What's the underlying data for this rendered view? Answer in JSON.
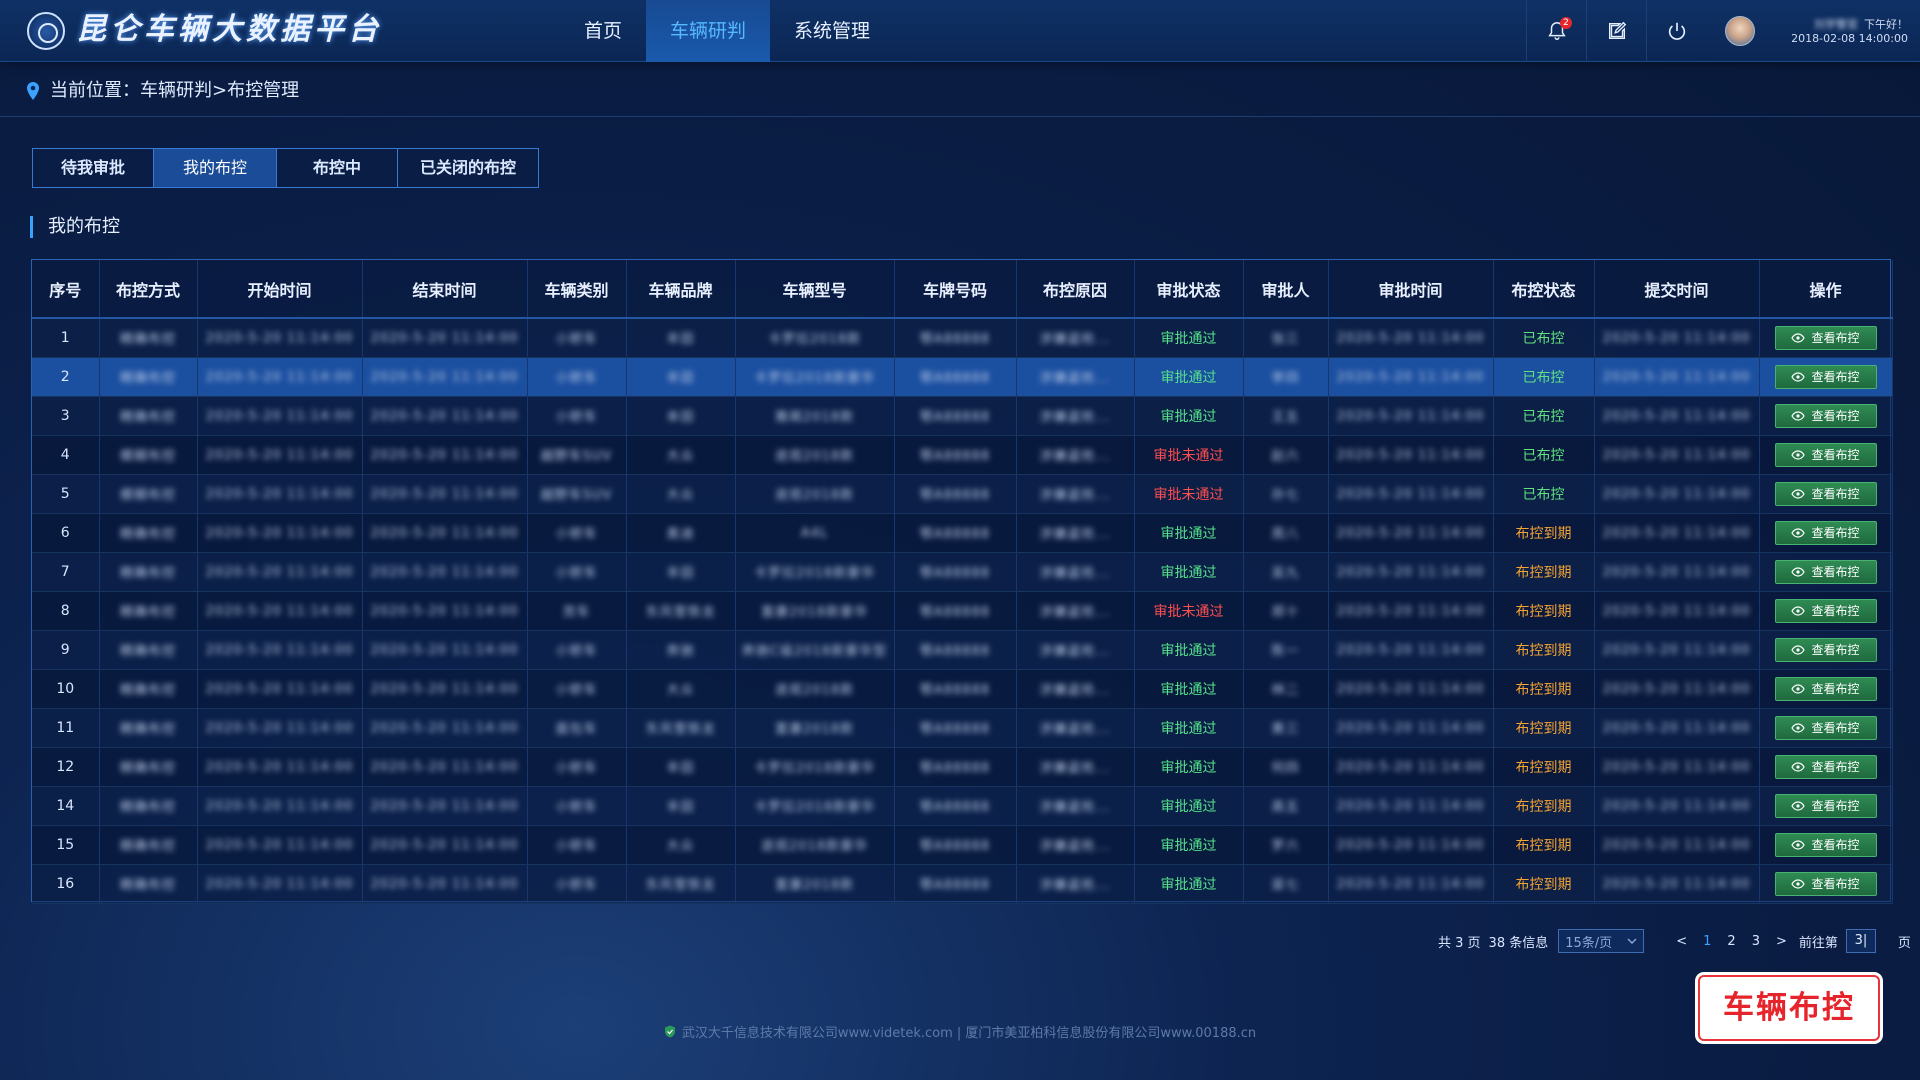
{
  "header": {
    "brand": "昆仑车辆大数据平台",
    "nav": [
      {
        "label": "首页",
        "active": false
      },
      {
        "label": "车辆研判",
        "active": true
      },
      {
        "label": "系统管理",
        "active": false
      }
    ],
    "notification_count": "2",
    "user": {
      "name": "刘学警官",
      "greeting": "下午好！",
      "datetime": "2018-02-08 14:00:00"
    }
  },
  "breadcrumb": {
    "prefix": "当前位置：",
    "items": [
      "车辆研判",
      "布控管理"
    ],
    "separator": ">"
  },
  "tabs": [
    {
      "label": "待我审批",
      "active": false
    },
    {
      "label": "我的布控",
      "active": true
    },
    {
      "label": "布控中",
      "active": false
    },
    {
      "label": "已关闭的布控",
      "active": false
    }
  ],
  "section_title": "我的布控",
  "table": {
    "columns": [
      "序号",
      "布控方式",
      "开始时间",
      "结束时间",
      "车辆类别",
      "车辆品牌",
      "车辆型号",
      "车牌号码",
      "布控原因",
      "审批状态",
      "审批人",
      "审批时间",
      "布控状态",
      "提交时间",
      "操作"
    ],
    "action_label": "查看布控",
    "rows": [
      {
        "no": "1",
        "method": "精确布控",
        "start": "2020-5-20 11:14:00",
        "end": "2020-5-20 11:14:00",
        "type": "小轿车",
        "brand": "丰田",
        "model": "卡罗拉2018款",
        "plate": "鄂A88888",
        "reason": "涉嫌盗抢...",
        "approval": "审批通过",
        "approver": "张三",
        "approve_time": "2020-5-20 11:14:00",
        "status": "已布控",
        "submit_time": "2020-5-20 11:14:00"
      },
      {
        "no": "2",
        "method": "精确布控",
        "start": "2020-5-20 11:14:00",
        "end": "2020-5-20 11:14:00",
        "type": "小轿车",
        "brand": "丰田",
        "model": "卡罗拉2018款豪华",
        "plate": "鄂A88888",
        "reason": "涉嫌盗抢...",
        "approval": "审批通过",
        "approver": "李四",
        "approve_time": "2020-5-20 11:14:00",
        "status": "已布控",
        "submit_time": "2020-5-20 11:14:00"
      },
      {
        "no": "3",
        "method": "精确布控",
        "start": "2020-5-20 11:14:00",
        "end": "2020-5-20 11:14:00",
        "type": "小轿车",
        "brand": "本田",
        "model": "雅阁2018款",
        "plate": "鄂A88888",
        "reason": "涉嫌盗抢...",
        "approval": "审批通过",
        "approver": "王五",
        "approve_time": "2020-5-20 11:14:00",
        "status": "已布控",
        "submit_time": "2020-5-20 11:14:00"
      },
      {
        "no": "4",
        "method": "模糊布控",
        "start": "2020-5-20 11:14:00",
        "end": "2020-5-20 11:14:00",
        "type": "越野车SUV",
        "brand": "大众",
        "model": "途观2018款",
        "plate": "鄂A88888",
        "reason": "涉嫌盗抢...",
        "approval": "审批未通过",
        "approver": "赵六",
        "approve_time": "2020-5-20 11:14:00",
        "status": "已布控",
        "submit_time": "2020-5-20 11:14:00"
      },
      {
        "no": "5",
        "method": "模糊布控",
        "start": "2020-5-20 11:14:00",
        "end": "2020-5-20 11:14:00",
        "type": "越野车SUV",
        "brand": "大众",
        "model": "途观2018款",
        "plate": "鄂A88888",
        "reason": "涉嫌盗抢...",
        "approval": "审批未通过",
        "approver": "孙七",
        "approve_time": "2020-5-20 11:14:00",
        "status": "已布控",
        "submit_time": "2020-5-20 11:14:00"
      },
      {
        "no": "6",
        "method": "精确布控",
        "start": "2020-5-20 11:14:00",
        "end": "2020-5-20 11:14:00",
        "type": "小轿车",
        "brand": "奥迪",
        "model": "A4L",
        "plate": "鄂A88888",
        "reason": "涉嫌盗抢...",
        "approval": "审批通过",
        "approver": "周八",
        "approve_time": "2020-5-20 11:14:00",
        "status": "布控到期",
        "submit_time": "2020-5-20 11:14:00"
      },
      {
        "no": "7",
        "method": "精确布控",
        "start": "2020-5-20 11:14:00",
        "end": "2020-5-20 11:14:00",
        "type": "小轿车",
        "brand": "丰田",
        "model": "卡罗拉2018款豪华",
        "plate": "鄂A88888",
        "reason": "涉嫌盗抢...",
        "approval": "审批通过",
        "approver": "吴九",
        "approve_time": "2020-5-20 11:14:00",
        "status": "布控到期",
        "submit_time": "2020-5-20 11:14:00"
      },
      {
        "no": "8",
        "method": "精确布控",
        "start": "2020-5-20 11:14:00",
        "end": "2020-5-20 11:14:00",
        "type": "货车",
        "brand": "东风雪铁龙",
        "model": "富康2018款豪华",
        "plate": "鄂A88888",
        "reason": "涉嫌盗抢...",
        "approval": "审批未通过",
        "approver": "郑十",
        "approve_time": "2020-5-20 11:14:00",
        "status": "布控到期",
        "submit_time": "2020-5-20 11:14:00"
      },
      {
        "no": "9",
        "method": "精确布控",
        "start": "2020-5-20 11:14:00",
        "end": "2020-5-20 11:14:00",
        "type": "小轿车",
        "brand": "奔驰",
        "model": "奔驰C级2018款豪华型",
        "plate": "鄂A88888",
        "reason": "涉嫌盗抢...",
        "approval": "审批通过",
        "approver": "陈一",
        "approve_time": "2020-5-20 11:14:00",
        "status": "布控到期",
        "submit_time": "2020-5-20 11:14:00"
      },
      {
        "no": "10",
        "method": "精确布控",
        "start": "2020-5-20 11:14:00",
        "end": "2020-5-20 11:14:00",
        "type": "小轿车",
        "brand": "大众",
        "model": "途观2018款",
        "plate": "鄂A88888",
        "reason": "涉嫌盗抢...",
        "approval": "审批通过",
        "approver": "林二",
        "approve_time": "2020-5-20 11:14:00",
        "status": "布控到期",
        "submit_time": "2020-5-20 11:14:00"
      },
      {
        "no": "11",
        "method": "精确布控",
        "start": "2020-5-20 11:14:00",
        "end": "2020-5-20 11:14:00",
        "type": "面包车",
        "brand": "东风雪铁龙",
        "model": "富康2018款",
        "plate": "鄂A88888",
        "reason": "涉嫌盗抢...",
        "approval": "审批通过",
        "approver": "黄三",
        "approve_time": "2020-5-20 11:14:00",
        "status": "布控到期",
        "submit_time": "2020-5-20 11:14:00"
      },
      {
        "no": "12",
        "method": "精确布控",
        "start": "2020-5-20 11:14:00",
        "end": "2020-5-20 11:14:00",
        "type": "小轿车",
        "brand": "丰田",
        "model": "卡罗拉2018款豪华",
        "plate": "鄂A88888",
        "reason": "涉嫌盗抢...",
        "approval": "审批通过",
        "approver": "何四",
        "approve_time": "2020-5-20 11:14:00",
        "status": "布控到期",
        "submit_time": "2020-5-20 11:14:00"
      },
      {
        "no": "14",
        "method": "精确布控",
        "start": "2020-5-20 11:14:00",
        "end": "2020-5-20 11:14:00",
        "type": "小轿车",
        "brand": "丰田",
        "model": "卡罗拉2018款豪华",
        "plate": "鄂A88888",
        "reason": "涉嫌盗抢...",
        "approval": "审批通过",
        "approver": "高五",
        "approve_time": "2020-5-20 11:14:00",
        "status": "布控到期",
        "submit_time": "2020-5-20 11:14:00"
      },
      {
        "no": "15",
        "method": "精确布控",
        "start": "2020-5-20 11:14:00",
        "end": "2020-5-20 11:14:00",
        "type": "小轿车",
        "brand": "大众",
        "model": "途观2018款豪华",
        "plate": "鄂A88888",
        "reason": "涉嫌盗抢...",
        "approval": "审批通过",
        "approver": "罗六",
        "approve_time": "2020-5-20 11:14:00",
        "status": "布控到期",
        "submit_time": "2020-5-20 11:14:00"
      },
      {
        "no": "16",
        "method": "精确布控",
        "start": "2020-5-20 11:14:00",
        "end": "2020-5-20 11:14:00",
        "type": "小轿车",
        "brand": "东风雪铁龙",
        "model": "富康2018款",
        "plate": "鄂A88888",
        "reason": "涉嫌盗抢...",
        "approval": "审批通过",
        "approver": "梁七",
        "approve_time": "2020-5-20 11:14:00",
        "status": "布控到期",
        "submit_time": "2020-5-20 11:14:00"
      }
    ]
  },
  "pagination": {
    "total_pages_text": "共 3 页",
    "total_items_text": "38 条信息",
    "page_size": "15条/页",
    "prev": "<",
    "next": ">",
    "pages": [
      "1",
      "2",
      "3"
    ],
    "current_page": "1",
    "goto_prefix": "前往第",
    "goto_value": "3|",
    "goto_suffix": "页"
  },
  "stamp_label": "车辆布控",
  "footer": {
    "text": "武汉大千信息技术有限公司www.videtek.com | 厦门市美亚柏科信息股份有限公司www.00188.cn"
  },
  "colors": {
    "accent": "#3ba1ff",
    "approved": "#55e08a",
    "rejected": "#ff4e4e",
    "controlled": "#62e27f",
    "expired": "#f5a332"
  }
}
